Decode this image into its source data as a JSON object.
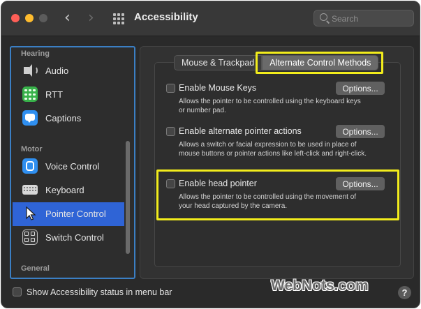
{
  "window": {
    "title": "Accessibility"
  },
  "search": {
    "placeholder": "Search"
  },
  "sidebar": {
    "sections": [
      {
        "label": "Hearing"
      },
      {
        "label": "Motor"
      },
      {
        "label": "General"
      }
    ],
    "items": [
      {
        "label": "Audio",
        "icon": "speaker-icon"
      },
      {
        "label": "RTT",
        "icon": "rtt-icon"
      },
      {
        "label": "Captions",
        "icon": "captions-icon"
      },
      {
        "label": "Voice Control",
        "icon": "voice-control-icon"
      },
      {
        "label": "Keyboard",
        "icon": "keyboard-icon"
      },
      {
        "label": "Pointer Control",
        "icon": "pointer-icon",
        "selected": true
      },
      {
        "label": "Switch Control",
        "icon": "switch-control-icon"
      }
    ]
  },
  "tabs": [
    {
      "label": "Mouse & Trackpad"
    },
    {
      "label": "Alternate Control Methods",
      "selected": true
    }
  ],
  "options": [
    {
      "title": "Enable Mouse Keys",
      "desc": "Allows the pointer to be controlled using the keyboard keys or number pad.",
      "button": "Options...",
      "checked": false
    },
    {
      "title": "Enable alternate pointer actions",
      "desc": "Allows a switch or facial expression to be used in place of mouse buttons or pointer actions like left-click and right-click.",
      "button": "Options...",
      "checked": false
    },
    {
      "title": "Enable head pointer",
      "desc": "Allows the pointer to be controlled using the movement of your head captured by the camera.",
      "button": "Options...",
      "checked": false
    }
  ],
  "footer": {
    "status_label": "Show Accessibility status in menu bar",
    "help": "?",
    "watermark": "WebNots.com"
  },
  "colors": {
    "accent_selected": "#2f64d6",
    "highlight": "#f2ec1c",
    "sidebar_border": "#3b7fc4"
  }
}
